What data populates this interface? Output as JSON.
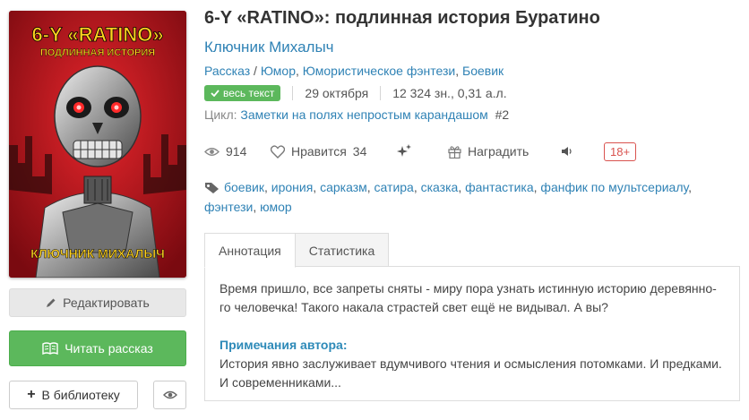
{
  "book": {
    "title": "6-Y «RATINO»: подлинная история Буратино",
    "author": "Ключник Михалыч",
    "genres": [
      "Рассказ",
      "Юмор",
      "Юмористическое фэнтези",
      "Боевик"
    ],
    "status_badge": "весь текст",
    "date": "29 октября",
    "size": "12 324 зн., 0,31 а.л.",
    "cycle_label": "Цикл:",
    "cycle_name": "Заметки на полях непростым карандашом",
    "cycle_number": "#2"
  },
  "cover": {
    "title_line1": "6-Y «RATINO»",
    "title_line2": "ПОДЛИННАЯ ИСТОРИЯ",
    "author": "КЛЮЧНИК МИХАЛЫЧ"
  },
  "stats": {
    "views": "914",
    "likes_label": "Нравится",
    "likes": "34",
    "reward_label": "Наградить",
    "age_rating": "18+"
  },
  "tags": [
    "боевик",
    "ирония",
    "сарказм",
    "сатира",
    "сказка",
    "фантастика",
    "фанфик по мультсериалу",
    "фэнтези",
    "юмор"
  ],
  "tabs": [
    {
      "label": "Аннотация"
    },
    {
      "label": "Статистика"
    }
  ],
  "annotation": {
    "text": "Время пришло, все запреты сняты - миру пора узнать истинную историю деревянно-го человечка! Такого накала страстей свет ещё не видывал. А вы?",
    "notes_title": "Примечания автора:",
    "notes_text": "История явно заслуживает вдумчивого чтения и осмысления потомками. И предками. И современниками..."
  },
  "buttons": {
    "edit": "Редактировать",
    "read": "Читать рассказ",
    "library": "В библиотеку"
  },
  "colors": {
    "link": "#2f82b5",
    "success": "#5cb85c",
    "danger": "#d9534f",
    "cover_red": "#b3121a"
  }
}
